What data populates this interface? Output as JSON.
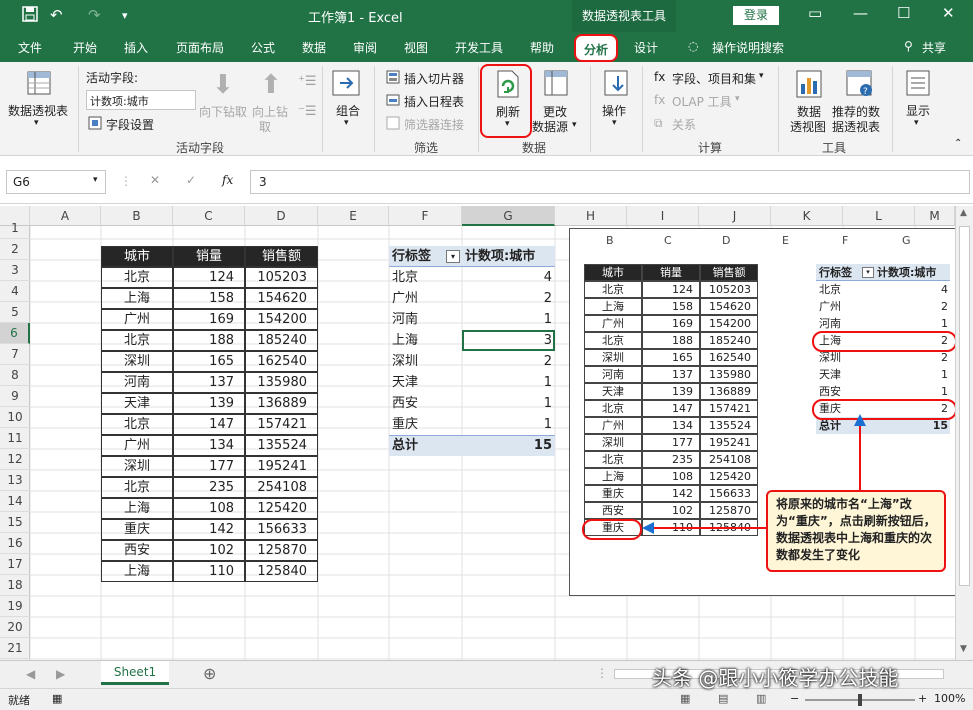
{
  "window": {
    "title": "工作簿1 - Excel",
    "context_tab": "数据透视表工具",
    "login": "登录"
  },
  "menu_tabs": [
    "文件",
    "开始",
    "插入",
    "页面布局",
    "公式",
    "数据",
    "审阅",
    "视图",
    "开发工具",
    "帮助",
    "分析",
    "设计",
    "操作说明搜索",
    "共享"
  ],
  "ribbon": {
    "pivot_table": "数据透视表",
    "active_field_label": "活动字段:",
    "active_field_value": "计数项:城市",
    "field_settings": "字段设置",
    "drill_down": "向下钻取",
    "drill_up_1": "向上钻",
    "drill_up_2": "取",
    "group": "组合",
    "insert_slicer": "插入切片器",
    "insert_timeline": "插入日程表",
    "filter_connections": "筛选器连接",
    "refresh": "刷新",
    "change_source_1": "更改",
    "change_source_2": "数据源",
    "actions": "操作",
    "fields_items": "字段、项目和集",
    "olap_tools": "OLAP 工具",
    "relationships": "关系",
    "pivot_chart_1": "数据",
    "pivot_chart_2": "透视图",
    "recommended_1": "推荐的数",
    "recommended_2": "据透视表",
    "show": "显示",
    "groups": {
      "active_field": "活动字段",
      "filter": "筛选",
      "data": "数据",
      "calculation": "计算",
      "tools": "工具"
    }
  },
  "formula_bar": {
    "name_box": "G6",
    "fx": "fx",
    "value": "3"
  },
  "columns": [
    "A",
    "B",
    "C",
    "D",
    "E",
    "F",
    "G",
    "H",
    "I",
    "J",
    "K",
    "L",
    "M"
  ],
  "rows": [
    "1",
    "2",
    "3",
    "4",
    "5",
    "6",
    "7",
    "8",
    "9",
    "10",
    "11",
    "12",
    "13",
    "14",
    "15",
    "16",
    "17",
    "18",
    "19",
    "20",
    "21"
  ],
  "source_table": {
    "headers": [
      "城市",
      "销量",
      "销售额"
    ],
    "rows": [
      [
        "北京",
        "124",
        "105203"
      ],
      [
        "上海",
        "158",
        "154620"
      ],
      [
        "广州",
        "169",
        "154200"
      ],
      [
        "北京",
        "188",
        "185240"
      ],
      [
        "深圳",
        "165",
        "162540"
      ],
      [
        "河南",
        "137",
        "135980"
      ],
      [
        "天津",
        "139",
        "136889"
      ],
      [
        "北京",
        "147",
        "157421"
      ],
      [
        "广州",
        "134",
        "135524"
      ],
      [
        "深圳",
        "177",
        "195241"
      ],
      [
        "北京",
        "235",
        "254108"
      ],
      [
        "上海",
        "108",
        "125420"
      ],
      [
        "重庆",
        "142",
        "156633"
      ],
      [
        "西安",
        "102",
        "125870"
      ],
      [
        "上海",
        "110",
        "125840"
      ]
    ]
  },
  "pivot": {
    "row_label": "行标签",
    "value_label": "计数项:城市",
    "rows": [
      [
        "北京",
        "4"
      ],
      [
        "广州",
        "2"
      ],
      [
        "河南",
        "1"
      ],
      [
        "上海",
        "3"
      ],
      [
        "深圳",
        "2"
      ],
      [
        "天津",
        "1"
      ],
      [
        "西安",
        "1"
      ],
      [
        "重庆",
        "1"
      ]
    ],
    "total_label": "总计",
    "total_value": "15"
  },
  "inset": {
    "columns": [
      "B",
      "C",
      "D",
      "E",
      "F",
      "G"
    ],
    "source_rows": [
      [
        "北京",
        "124",
        "105203"
      ],
      [
        "上海",
        "158",
        "154620"
      ],
      [
        "广州",
        "169",
        "154200"
      ],
      [
        "北京",
        "188",
        "185240"
      ],
      [
        "深圳",
        "165",
        "162540"
      ],
      [
        "河南",
        "137",
        "135980"
      ],
      [
        "天津",
        "139",
        "136889"
      ],
      [
        "北京",
        "147",
        "157421"
      ],
      [
        "广州",
        "134",
        "135524"
      ],
      [
        "深圳",
        "177",
        "195241"
      ],
      [
        "北京",
        "235",
        "254108"
      ],
      [
        "上海",
        "108",
        "125420"
      ],
      [
        "重庆",
        "142",
        "156633"
      ],
      [
        "西安",
        "102",
        "125870"
      ],
      [
        "重庆",
        "110",
        "125840"
      ]
    ],
    "pivot_rows": [
      [
        "北京",
        "4"
      ],
      [
        "广州",
        "2"
      ],
      [
        "河南",
        "1"
      ],
      [
        "上海",
        "2"
      ],
      [
        "深圳",
        "2"
      ],
      [
        "天津",
        "1"
      ],
      [
        "西安",
        "1"
      ],
      [
        "重庆",
        "2"
      ]
    ],
    "total_value": "15"
  },
  "callout": "将原来的城市名“上海”改为“重庆”，点击刷新按钮后，数据透视表中上海和重庆的次数都发生了变化",
  "sheet_tab": "Sheet1",
  "status": {
    "ready": "就绪",
    "zoom": "100%"
  },
  "watermark": "头条 @跟小小筱学办公技能",
  "colors": {
    "excel_green": "#217346",
    "highlight_red": "#e11111",
    "table_header": "#262626",
    "pivot_header": "#dce6f1"
  }
}
